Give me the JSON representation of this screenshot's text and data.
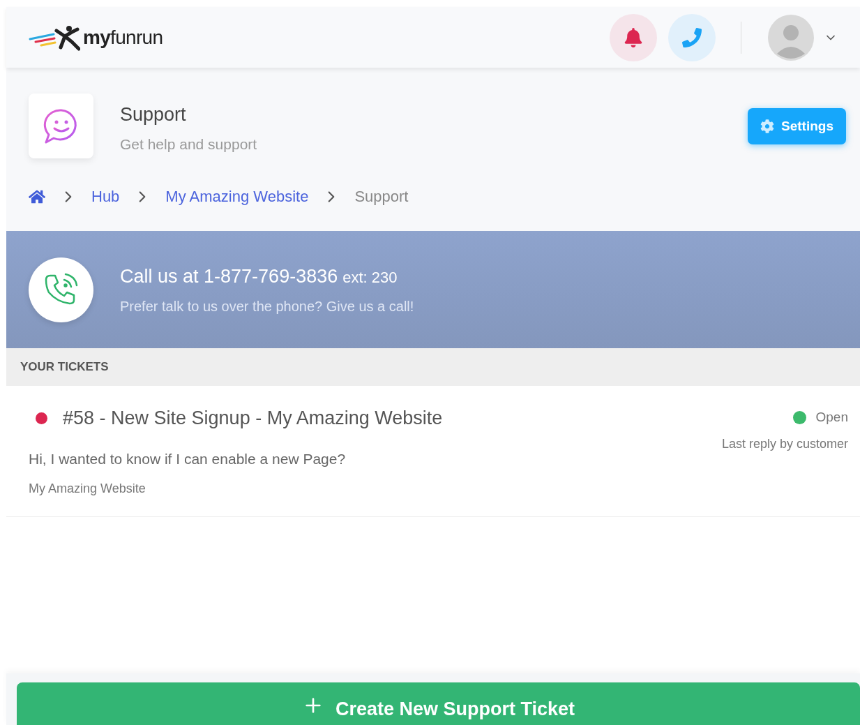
{
  "header": {
    "logo": "**my**funrun"
  },
  "page": {
    "title": "Support",
    "subtitle": "Get help and support",
    "settings_button": "Settings"
  },
  "breadcrumbs": [
    {
      "label": "Hub",
      "kind": "link"
    },
    {
      "label": "My Amazing Website",
      "kind": "link"
    },
    {
      "label": "Support",
      "kind": "current"
    }
  ],
  "call_banner": {
    "title": "Call us at 1-877-769-3836",
    "ext": "ext: 230",
    "subtitle": "Prefer talk to us over the phone? Give us a call!"
  },
  "tickets": {
    "heading": "YOUR TICKETS",
    "items": [
      {
        "title": "#58 - New Site Signup - My Amazing Website",
        "color": "#dc2650",
        "message": "Hi, I wanted to know if I can enable a new Page?",
        "site": "My Amazing Website",
        "status": {
          "label": "Open",
          "color": "#3cba6c"
        },
        "last_reply": "Last reply by customer"
      }
    ]
  },
  "create_button": "Create New Support Ticket"
}
